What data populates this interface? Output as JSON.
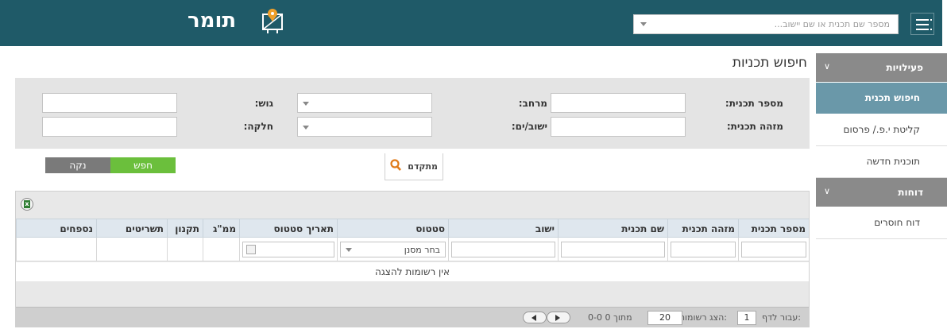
{
  "header": {
    "app_name": "תומר",
    "search_placeholder": "מספר שם תכנית או שם יישוב...",
    "menu_icon": "hamburger-menu-icon",
    "logo_icon": "map-pin-board-icon",
    "bg_color": "#1f5a68"
  },
  "page": {
    "title": "חיפוש תכניות"
  },
  "sidebar": {
    "sections": [
      {
        "label": "פעילויות",
        "items": [
          {
            "label": "חיפוש תכנית",
            "active": true
          },
          {
            "label": "קליטת י.פ./ פרסום",
            "active": false
          },
          {
            "label": "תוכנית חדשה",
            "active": false
          }
        ]
      },
      {
        "label": "דוחות",
        "items": [
          {
            "label": "דוח חוסרים",
            "active": false
          }
        ]
      }
    ]
  },
  "form": {
    "plan_number_label": "מספר תכנית:",
    "plan_id_label": "מזהה תכנית:",
    "district_label": "מרחב:",
    "settlement_label": "ישוב/ים:",
    "block_label": "גוש:",
    "parcel_label": "חלקה:",
    "advanced_label": "מתקדם",
    "search_button": "חפש",
    "clear_button": "נקה"
  },
  "table": {
    "columns": [
      "מספר תכנית",
      "מזהה תכנית",
      "שם תכנית",
      "ישוב",
      "סטטוס",
      "תאריך סטטוס",
      "ממ\"ג",
      "תקנון",
      "תשריטים",
      "נספחים"
    ],
    "status_filter_value": "בחר מסנן",
    "empty_message": "אין רשומות להצגה"
  },
  "pager": {
    "goto_label": "עבור לדף:",
    "page_value": "1",
    "show_label": "הצג רשומות:",
    "page_size": "20",
    "range_text": "0-0 מתוך 0"
  }
}
